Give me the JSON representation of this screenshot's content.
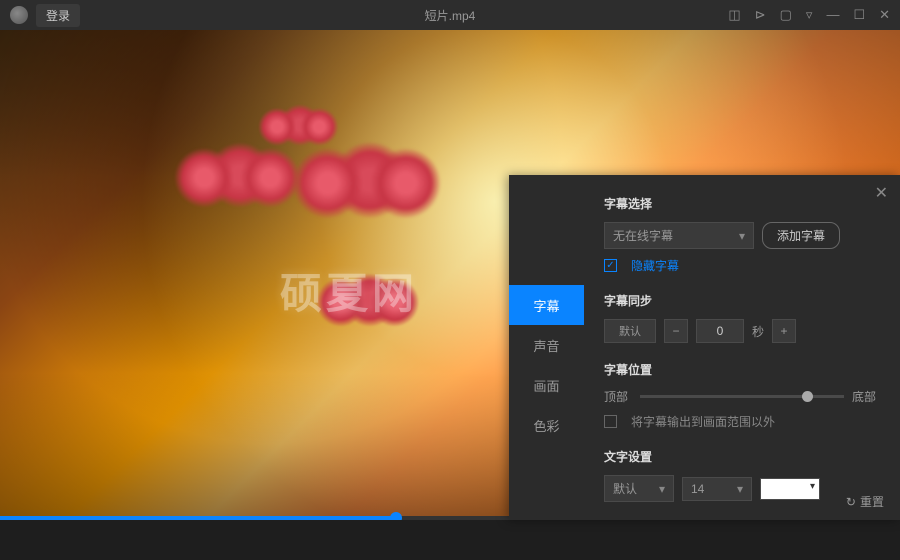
{
  "header": {
    "login": "登录",
    "title": "短片.mp4"
  },
  "watermark": "硕夏网",
  "tabs": {
    "subtitle": "字幕",
    "sound": "声音",
    "picture": "画面",
    "color": "色彩"
  },
  "panel": {
    "sub_select": {
      "title": "字幕选择",
      "dropdown": "无在线字幕",
      "add_btn": "添加字幕",
      "hide_label": "隐藏字幕"
    },
    "sync": {
      "title": "字幕同步",
      "default_btn": "默认",
      "value": "0",
      "unit": "秒"
    },
    "position": {
      "title": "字幕位置",
      "top": "顶部",
      "bottom": "底部",
      "output_label": "将字幕输出到画面范围以外"
    },
    "text": {
      "title": "文字设置",
      "font": "默认",
      "size": "14"
    },
    "reset": "重置"
  }
}
